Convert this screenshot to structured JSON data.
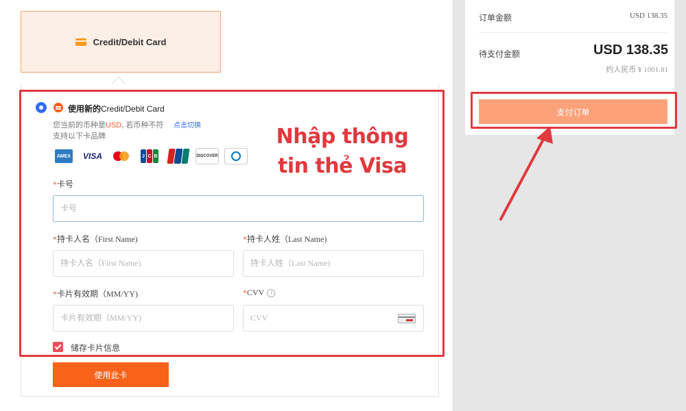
{
  "payment_tab": {
    "label": "Credit/Debit Card"
  },
  "card_section": {
    "title_bold": "使用新的",
    "title_rest": "Credit/Debit Card",
    "currency_prefix": "您当前的币种是",
    "currency_code": "USD",
    "currency_suffix": ", 若币种不符",
    "switch_link": "点击切换",
    "brands_note": "支持以下卡品牌",
    "brands": [
      "amex-logo",
      "visa-logo",
      "mastercard-logo",
      "jcb-logo",
      "unionpay-logo",
      "discover-logo",
      "diners-club-logo"
    ]
  },
  "annotation": {
    "line1": "Nhập thông",
    "line2": "tin thẻ Visa",
    "color": "#e0393e"
  },
  "form": {
    "required_mark": "*",
    "card_number": {
      "label": "卡号",
      "placeholder": "卡号"
    },
    "first_name": {
      "label": "持卡人名（First Name)",
      "placeholder": "持卡人名（First Name)"
    },
    "last_name": {
      "label": "持卡人姓（Last Name)",
      "placeholder": "持卡人姓（Last Name)"
    },
    "expiry": {
      "label": "卡片有效期（MM/YY)",
      "placeholder": "卡片有效期（MM/YY)"
    },
    "cvv": {
      "label": "CVV",
      "placeholder": "CVV",
      "info_icon": "info-icon",
      "card_icon": "card-back-icon"
    },
    "save_card": {
      "label": "储存卡片信息",
      "checked": true
    },
    "use_card_button": "使用此卡"
  },
  "summary": {
    "order_amount_label": "订单金额",
    "order_amount_value": "USD 138.35",
    "due_label": "待支付金额",
    "due_value": "USD 138.35",
    "rmb_value": "约人民币 ¥ 1001.81",
    "pay_button": "支付订单"
  },
  "colors": {
    "accent": "#f9621a",
    "pay_button": "#fca27a",
    "link": "#2f6bff",
    "annotation": "#e0393e"
  }
}
